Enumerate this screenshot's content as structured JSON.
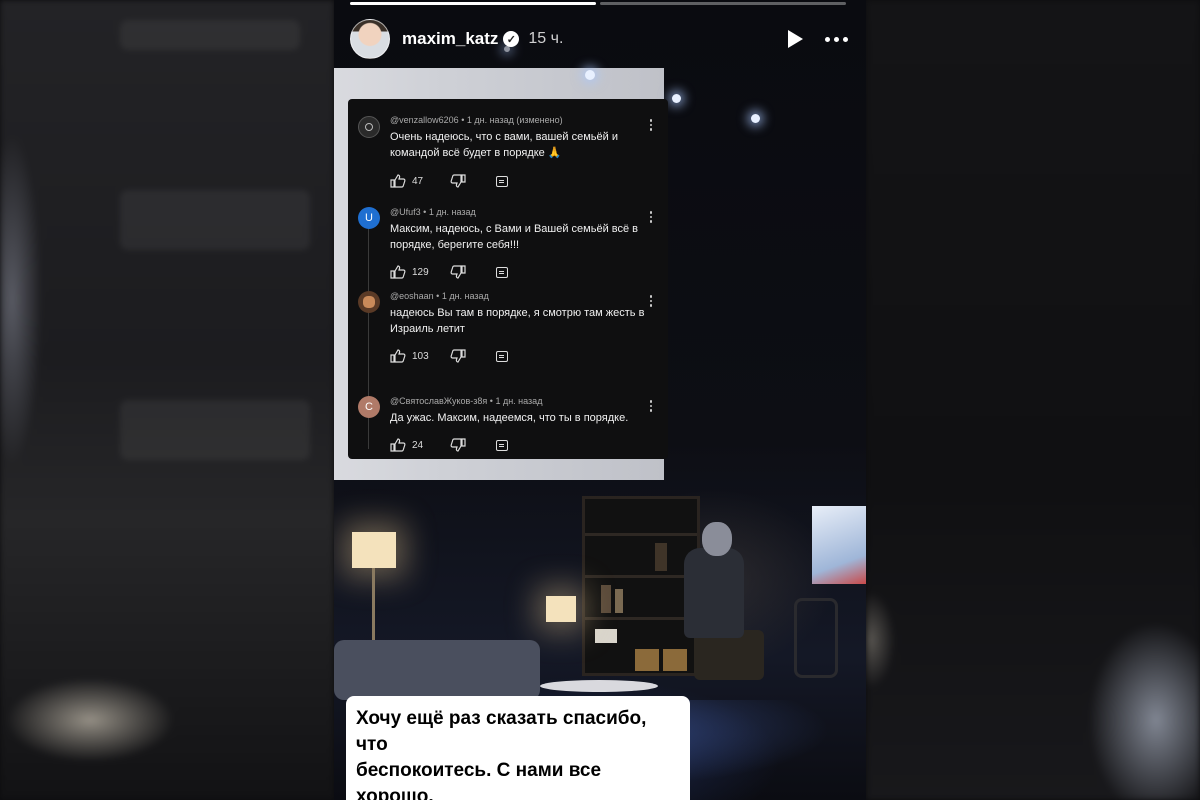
{
  "story": {
    "username": "maxim_katz",
    "posted_ago": "15 ч.",
    "progress": [
      1.0,
      0.0
    ]
  },
  "comments": [
    {
      "author": "@venzallow6206",
      "time": "1 дн. назад (изменено)",
      "text": "Очень надеюсь, что с вами, вашей семьёй и командой всё будет в порядке 🙏",
      "likes": "47",
      "avatar_letter": "",
      "avatar_color": "#2a2a2a"
    },
    {
      "author": "@Ufuf3",
      "time": "1 дн. назад",
      "text": "Максим, надеюсь, с Вами и Вашей семьёй всё в порядке, берегите себя!!!",
      "likes": "129",
      "avatar_letter": "U",
      "avatar_color": "#1f6fd1"
    },
    {
      "author": "@eoshaan",
      "time": "1 дн. назад",
      "text": "надеюсь Вы там в порядке, я смотрю там жесть в Израиль летит",
      "likes": "103",
      "avatar_letter": "",
      "avatar_color": "#7a4a2a"
    },
    {
      "author": "@СвятославЖуков-з8я",
      "time": "1 дн. назад",
      "text": "Да ужас. Максим, надеемся, что ты в порядке.",
      "likes": "24",
      "avatar_letter": "С",
      "avatar_color": "#b07a68"
    }
  ],
  "caption": {
    "line1": "Хочу ещё раз сказать спасибо, что",
    "line2": "беспокоитесь. С нами все хорошо."
  }
}
